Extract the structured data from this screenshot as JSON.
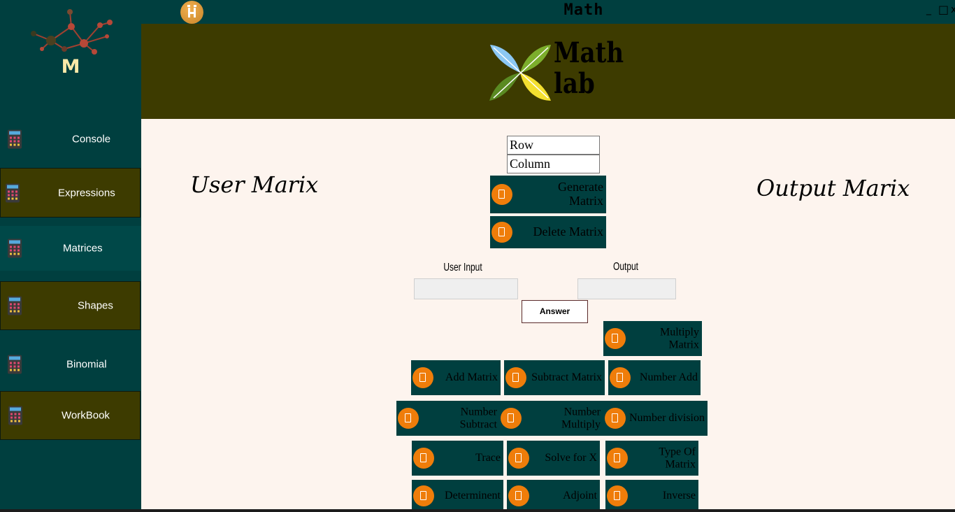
{
  "window": {
    "title": "Math",
    "minimize": "_",
    "maximize": "□",
    "close": "x"
  },
  "brand": {
    "logo_letter": "M",
    "header_logo_text": [
      "Math",
      "lab"
    ]
  },
  "sidebar": {
    "items": [
      {
        "label": "Console"
      },
      {
        "label": "Expressions"
      },
      {
        "label": "Matrices"
      },
      {
        "label": "Shapes"
      },
      {
        "label": "Binomial"
      },
      {
        "label": "WorkBook"
      }
    ]
  },
  "matrix_page": {
    "user_heading": "User Marix",
    "output_heading": "Output Marix",
    "row_value": "Row",
    "column_value": "Column",
    "generate_button": [
      "Generate",
      "Matrix"
    ],
    "delete_button": "Delete Matrix",
    "user_input_label": "User Input",
    "output_label": "Output",
    "answer_button": "Answer",
    "operations": {
      "multiply": [
        "Multiply",
        "Matrix"
      ],
      "add": "Add Matrix",
      "subtract": "Subtract Matrix",
      "number_add": "Number Add",
      "number_subtract": [
        "Number",
        "Subtract"
      ],
      "number_multiply": [
        "Number",
        "Multiply"
      ],
      "number_division": "Number division",
      "trace": "Trace",
      "solve_x": "Solve for X",
      "type_of_matrix": [
        "Type Of",
        "Matrix"
      ],
      "determinant": "Determinent",
      "adjoint": "Adjoint",
      "inverse": "Inverse"
    }
  },
  "colors": {
    "sidebar": "#003f3f",
    "header": "#3d3b00",
    "content": "#fdf4ee",
    "accent": "#ef7d0a"
  },
  "icons": {
    "nav": "calculator-icon",
    "button": "calculator-icon"
  }
}
